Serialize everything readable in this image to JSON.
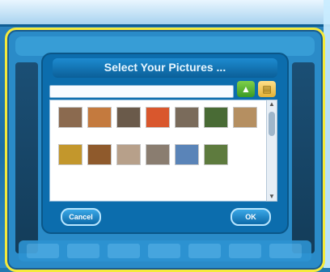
{
  "app": {
    "frame_header_left": "",
    "frame_header_right": ""
  },
  "dialog": {
    "title": "Select Your Pictures ...",
    "path": "",
    "up_icon": "up-arrow-icon",
    "folder_icon": "folder-icon",
    "thumbnails": [
      {
        "label": "",
        "color": "#8b6a4f"
      },
      {
        "label": "",
        "color": "#c47a3e"
      },
      {
        "label": "",
        "color": "#6a5a4a"
      },
      {
        "label": "",
        "color": "#d9572d"
      },
      {
        "label": "",
        "color": "#7a6b5b"
      },
      {
        "label": "",
        "color": "#496b35"
      },
      {
        "label": "",
        "color": "#b58f61"
      },
      {
        "label": "",
        "color": "#c3972c"
      },
      {
        "label": "",
        "color": "#8f5a2c"
      },
      {
        "label": "",
        "color": "#b7a08a"
      },
      {
        "label": "",
        "color": "#8a7d70"
      },
      {
        "label": "",
        "color": "#5a84b8"
      },
      {
        "label": "",
        "color": "#5e7b3e"
      }
    ],
    "cancel_label": "Cancel",
    "ok_label": "OK",
    "hint": ""
  }
}
